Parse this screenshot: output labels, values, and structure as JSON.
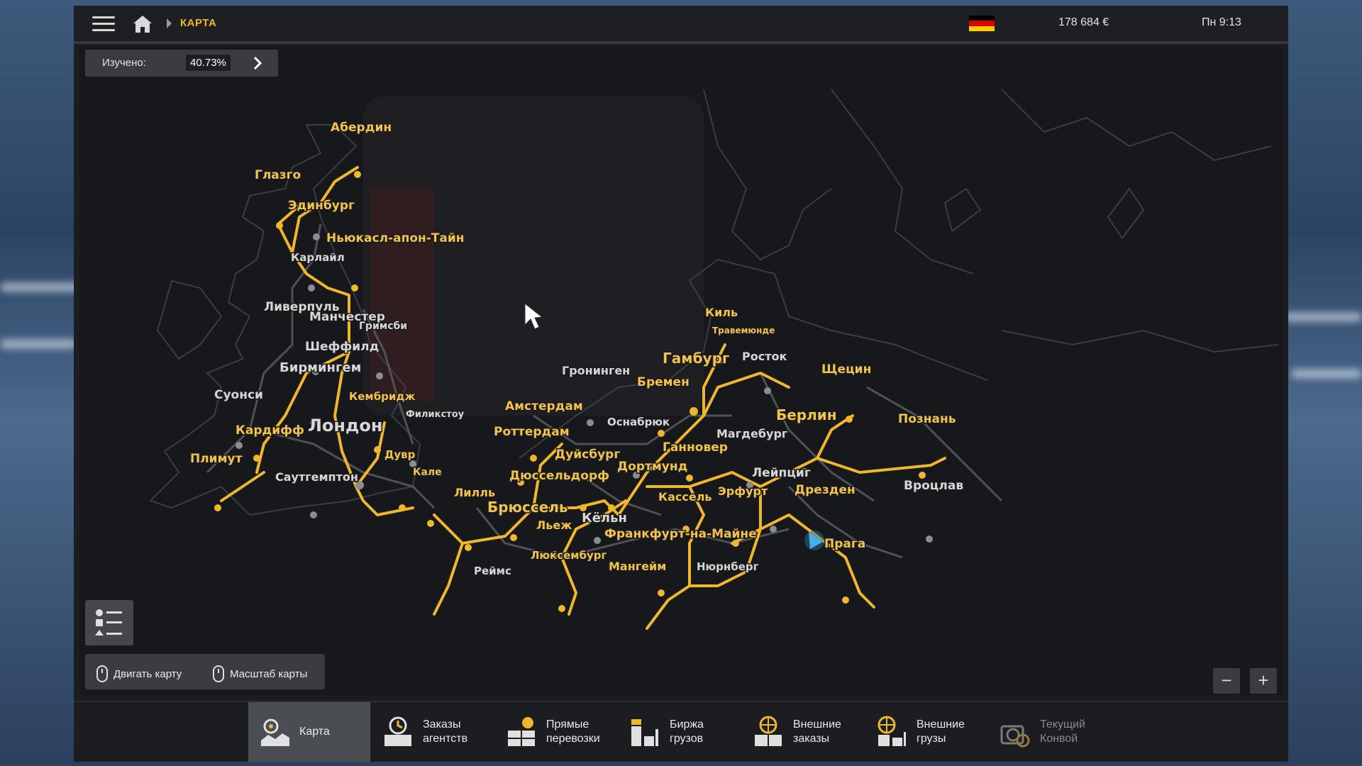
{
  "topbar": {
    "breadcrumb": "КАРТА",
    "money": "178 684 €",
    "time": "Пн 9:13",
    "flag_colors": [
      "#000000",
      "#dd0000",
      "#ffce00"
    ]
  },
  "map": {
    "explored_label": "Изучено:",
    "explored_value": "40.73%",
    "cities": [
      "Абердин",
      "Глазго",
      "Эдинбург",
      "Ньюкасл-апон-Тайн",
      "Карлайл",
      "Ливерпуль",
      "Манчестер",
      "Гримсби",
      "Шеффилд",
      "Бирмингем",
      "Суонси",
      "Кембридж",
      "Филикстоу",
      "Кардифф",
      "Лондон",
      "Плимут",
      "Дувр",
      "Саутгемптон",
      "Кале",
      "Лилль",
      "Брюссель",
      "Льеж",
      "Кёльн",
      "Реймс",
      "Люксембург",
      "Амстердам",
      "Роттердам",
      "Дуйсбург",
      "Дюссельдорф",
      "Гронинген",
      "Бремен",
      "Оснабрюк",
      "Дортмунд",
      "Ганновер",
      "Гамбург",
      "Киль",
      "Травемюнде",
      "Росток",
      "Магдебург",
      "Кассель",
      "Франкфурт-на-Майне",
      "Мангейм",
      "Нюрнберг",
      "Эрфурт",
      "Лейпциг",
      "Дрезден",
      "Берлин",
      "Щецин",
      "Познань",
      "Вроцлав",
      "Прага"
    ],
    "hint_move": "Двигать карту",
    "hint_zoom": "Масштаб карты",
    "zoom_out": "−",
    "zoom_in": "+",
    "accent_color": "#f0b62c"
  },
  "tabs": [
    {
      "label": "Карта",
      "icon": "map-icon"
    },
    {
      "label": "Заказы\nагентств",
      "icon": "agency-orders-icon"
    },
    {
      "label": "Прямые\nперевозки",
      "icon": "direct-transport-icon"
    },
    {
      "label": "Биржа\nгрузов",
      "icon": "cargo-market-icon"
    },
    {
      "label": "Внешние\nзаказы",
      "icon": "external-orders-icon"
    },
    {
      "label": "Внешние\nгрузы",
      "icon": "external-cargo-icon"
    },
    {
      "label": "Текущий\nКонвой",
      "icon": "convoy-icon"
    }
  ]
}
